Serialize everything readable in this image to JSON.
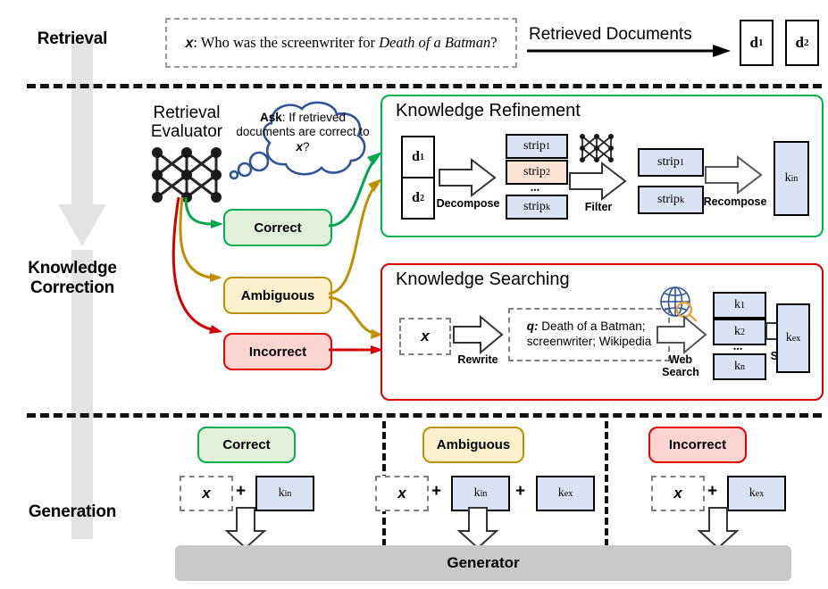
{
  "stages": {
    "retrieval": "Retrieval",
    "correction_line1": "Knowledge",
    "correction_line2": "Correction",
    "generation": "Generation"
  },
  "retrieval": {
    "query_prefix": "x",
    "query_colon": ": Who was the screenwriter for ",
    "query_italic": "Death of a Batman",
    "query_suffix": "?",
    "arrow_label": "Retrieved Documents",
    "documents": [
      "d",
      "d"
    ],
    "document_subs": [
      "1",
      "2"
    ]
  },
  "evaluator": {
    "title_line1": "Retrieval",
    "title_line2": "Evaluator",
    "bubble_bold": "Ask",
    "bubble_rest": ": If retrieved documents are correct to ",
    "bubble_x": "x",
    "bubble_end": "?",
    "icon": "neural-network-icon"
  },
  "labels": {
    "correct": "Correct",
    "ambiguous": "Ambiguous",
    "incorrect": "Incorrect"
  },
  "refinement": {
    "title": "Knowledge Refinement",
    "docs": [
      {
        "base": "d",
        "sub": "1"
      },
      {
        "base": "d",
        "sub": "2"
      }
    ],
    "step_decompose": "Decompose",
    "strips_in": [
      {
        "base": "strip",
        "sub": "1",
        "tint": "blue"
      },
      {
        "base": "strip",
        "sub": "2",
        "tint": "peach"
      },
      {
        "base": "strip",
        "sub": "k",
        "tint": "blue"
      }
    ],
    "ellipsis": "...",
    "step_filter": "Filter",
    "filter_icon": "neural-network-icon",
    "strips_out": [
      {
        "base": "strip",
        "sub": "1"
      },
      {
        "base": "strip",
        "sub": "k"
      }
    ],
    "step_recompose": "Recompose",
    "output": {
      "base": "k",
      "sub": "in"
    }
  },
  "searching": {
    "title": "Knowledge Searching",
    "input_x": "x",
    "step_rewrite": "Rewrite",
    "query_label": "q:",
    "query_line1": " Death of a Batman;",
    "query_line2": "screenwriter; Wikipedia",
    "web_icon": "globe-search-icon",
    "step_websearch_line1": "Web",
    "step_websearch_line2": "Search",
    "results": [
      {
        "base": "k",
        "sub": "1"
      },
      {
        "base": "k",
        "sub": "2"
      },
      {
        "base": "k",
        "sub": "n"
      }
    ],
    "ellipsis": "...",
    "step_select": "Select",
    "output": {
      "base": "k",
      "sub": "ex"
    }
  },
  "generation": {
    "columns": [
      {
        "label": "Correct",
        "kind": "correct",
        "x_chip": "x",
        "plus": "+",
        "items": [
          {
            "base": "k",
            "sub": "in"
          }
        ]
      },
      {
        "label": "Ambiguous",
        "kind": "ambiguous",
        "x_chip": "x",
        "plus": "+",
        "items": [
          {
            "base": "k",
            "sub": "in"
          },
          {
            "base": "k",
            "sub": "ex"
          }
        ]
      },
      {
        "label": "Incorrect",
        "kind": "incorrect",
        "x_chip": "x",
        "plus": "+",
        "items": [
          {
            "base": "k",
            "sub": "ex"
          }
        ]
      }
    ],
    "generator": "Generator"
  },
  "colors": {
    "green": "#00b050",
    "amber": "#bf9000",
    "red": "#d40000",
    "blue_fill": "#dae3f3",
    "peach_fill": "#fbe2d5",
    "grey_arrow": "#e3e3e3",
    "generator_bar": "#c9c9c9"
  }
}
